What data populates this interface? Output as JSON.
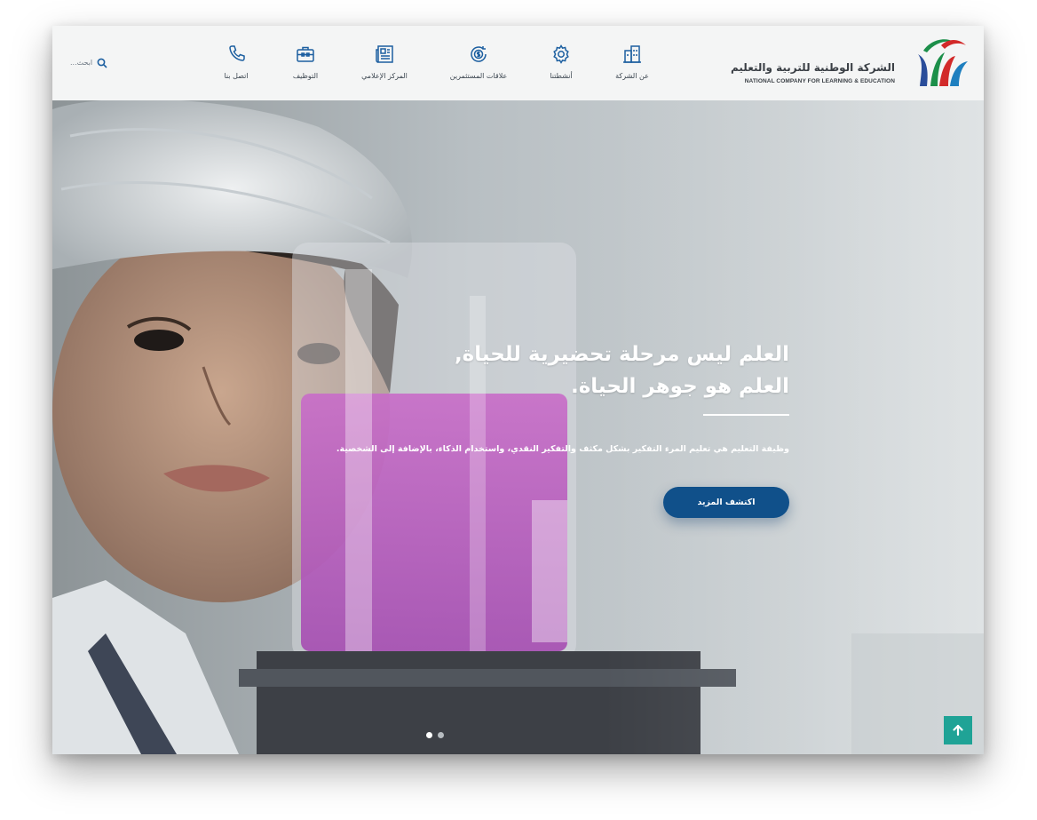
{
  "brand": {
    "name_ar": "الشركة الوطنية للتربية والتعليم",
    "name_en": "NATIONAL COMPANY FOR LEARNING & EDUCATION",
    "logo_icon": "stylized-figures-logo"
  },
  "nav": {
    "items": [
      {
        "label": "عن الشركة",
        "icon": "building-icon"
      },
      {
        "label": "أنشطتنا",
        "icon": "gear-icon"
      },
      {
        "label": "علاقات المستثمرين",
        "icon": "coin-chart-icon"
      },
      {
        "label": "المركز الإعلامي",
        "icon": "newspaper-icon"
      },
      {
        "label": "التوظيف",
        "icon": "briefcase-icon"
      },
      {
        "label": "اتصل بنا",
        "icon": "phone-icon"
      }
    ],
    "search_placeholder": "ابحث..."
  },
  "hero": {
    "headline_line1": "العلم ليس مرحلة تحضيرية للحياة,",
    "headline_line2": "العلم هو جوهر الحياة.",
    "subtitle": "وظيفة التعليم هي تعليم المرء التفكير بشكل مكثف والتفكير النقدي، واستخدام الذكاء، بالإضافة إلى الشخصية.",
    "cta_label": "اكتشف المزيد",
    "slides": {
      "count": 2,
      "active": 1
    }
  },
  "colors": {
    "primary": "#10508a",
    "nav_icon": "#1c5fa0",
    "back_to_top": "#1fa396",
    "header_bg": "#f4f5f5"
  }
}
